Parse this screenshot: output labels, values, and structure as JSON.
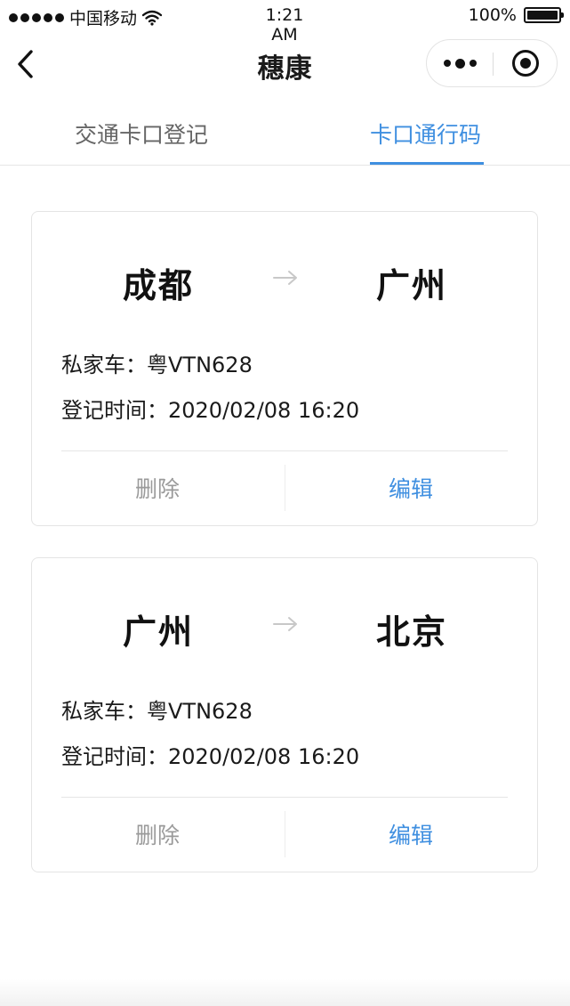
{
  "status_bar": {
    "carrier": "中国移动",
    "time": "1:21\nAM",
    "battery": "100%"
  },
  "nav": {
    "title": "穗康",
    "icons": {
      "back": "chevron-left-icon",
      "more": "more-dots-icon",
      "close": "target-circle-icon"
    }
  },
  "tabs": [
    {
      "label": "交通卡口登记",
      "active": false
    },
    {
      "label": "卡口通行码",
      "active": true
    }
  ],
  "records": [
    {
      "from": "成都",
      "to": "广州",
      "car": "私家车：粤VTN628",
      "time": "登记时间：2020/02/08 16:20",
      "delete_label": "删除",
      "edit_label": "编辑"
    },
    {
      "from": "广州",
      "to": "北京",
      "car": "私家车：粤VTN628",
      "time": "登记时间：2020/02/08 16:20",
      "delete_label": "删除",
      "edit_label": "编辑"
    }
  ],
  "colors": {
    "accent": "#3f8fe0",
    "muted": "#9a9a9a",
    "text": "#1a1a1a"
  }
}
